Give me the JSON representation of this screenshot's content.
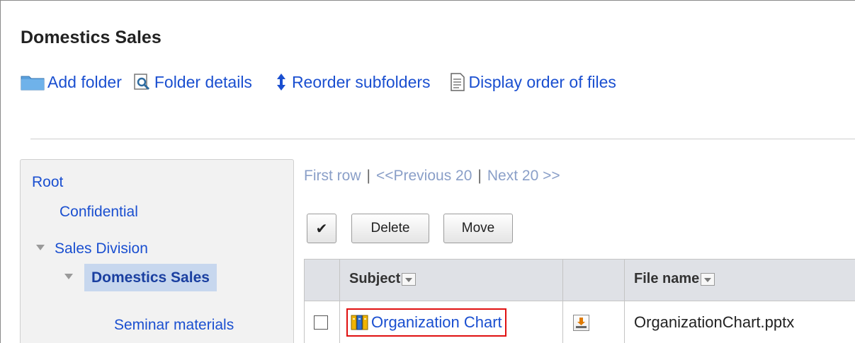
{
  "header": {
    "title": "Domestics Sales"
  },
  "toolbar": {
    "add_folder": "Add folder",
    "folder_details": "Folder details",
    "reorder_subfolders": "Reorder subfolders",
    "display_order": "Display order of files",
    "icons": [
      "folder-icon",
      "magnifier-icon",
      "up-down-arrow-icon",
      "document-icon"
    ],
    "link_color": "#1a4fd0"
  },
  "tree": {
    "root": "Root",
    "confidential": "Confidential",
    "sales_division": "Sales Division",
    "domestics_sales": "Domestics Sales",
    "seminar_materials": "Seminar materials",
    "selected_bg": "#c7d7ee"
  },
  "pager": {
    "first": "First row",
    "previous": "<<Previous 20",
    "next": "Next 20 >>",
    "separator": "|"
  },
  "actions": {
    "check_all": "✔",
    "delete": "Delete",
    "move": "Move"
  },
  "table": {
    "columns": {
      "subject": "Subject",
      "file_name": "File name"
    },
    "rows": [
      {
        "subject": "Organization Chart",
        "file_name": "OrganizationChart.pptx"
      }
    ],
    "highlight_color": "#e01010"
  }
}
